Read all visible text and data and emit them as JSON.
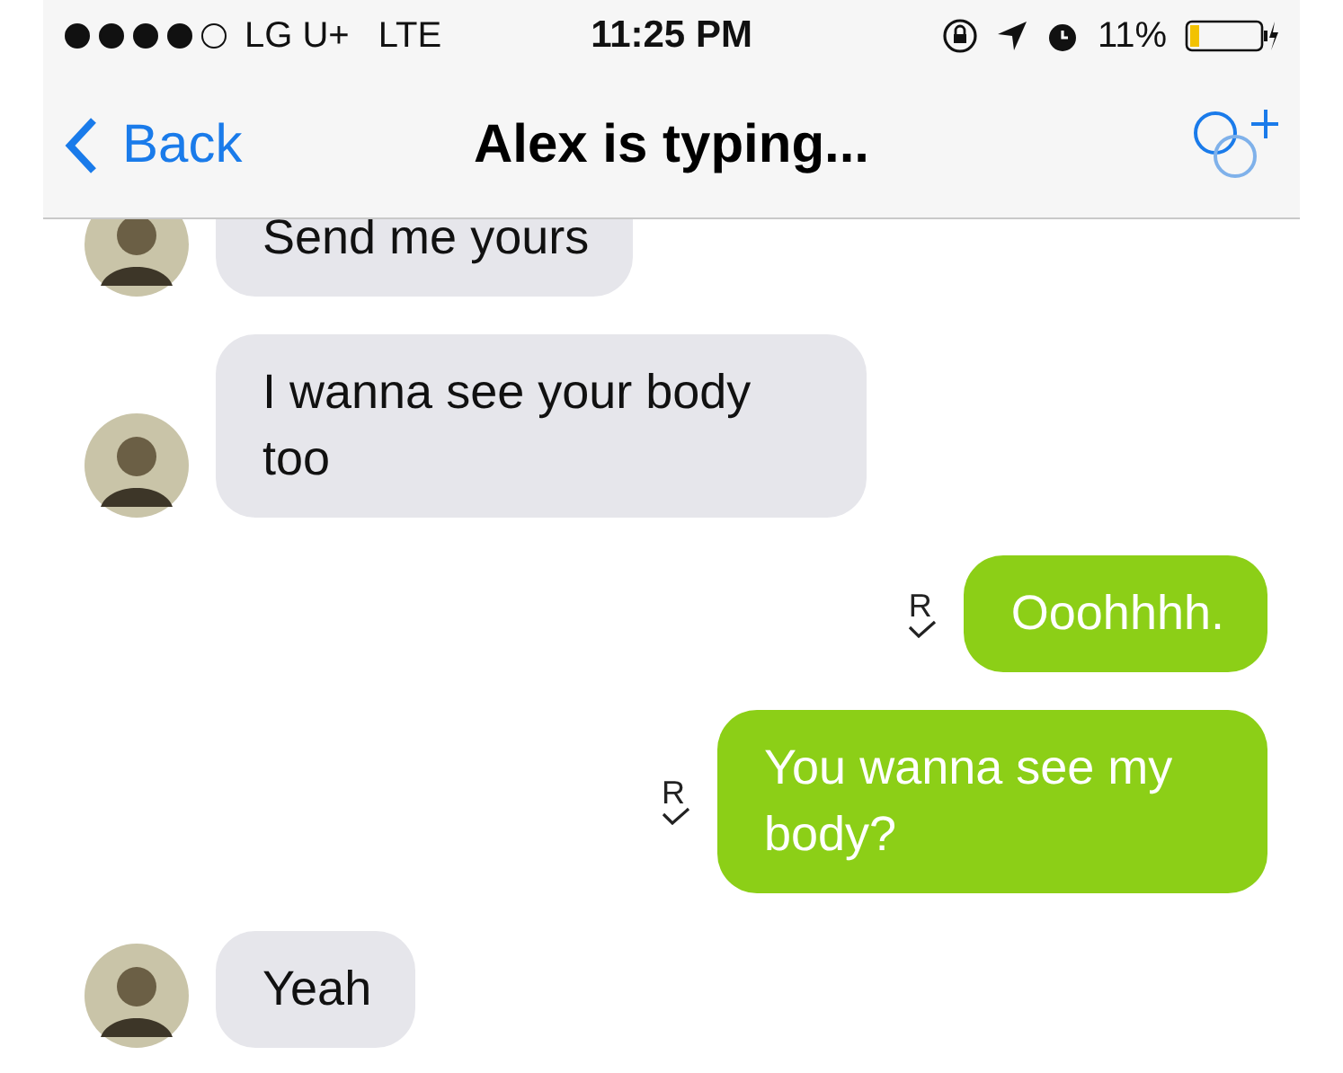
{
  "status_bar": {
    "carrier": "LG U+",
    "network": "LTE",
    "time": "11:25 PM",
    "battery": "11%"
  },
  "nav_bar": {
    "back": "Back",
    "title": "Alex is typing..."
  },
  "messages": [
    {
      "kind": "incoming",
      "text": "Send me yours"
    },
    {
      "kind": "incoming",
      "text": "I wanna see your body too"
    },
    {
      "kind": "outgoing",
      "text": "Ooohhhh.",
      "receipt": "R"
    },
    {
      "kind": "outgoing",
      "text": "You wanna see my body?",
      "receipt": "R"
    },
    {
      "kind": "incoming",
      "text": "Yeah"
    }
  ]
}
